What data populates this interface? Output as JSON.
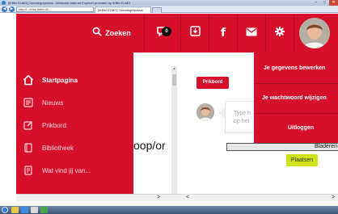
{
  "window": {
    "title": "[IKBM ELMO] Ckemiegrepstaal - Windows Internet Explorer provided by IKBM ELMO",
    "minimize": "–",
    "maximize": "□",
    "close": "✕"
  },
  "browser": {
    "url": "http://...elmo.ikbm.nl/...",
    "tab_label": "[IKBM ELMO] Ckemiegrepstaal",
    "back": "◀",
    "forward": "▶"
  },
  "header": {
    "search_label": "Zoeken",
    "chat_badge": "0",
    "facebook_label": "f"
  },
  "sidebar": {
    "items": [
      {
        "label": "Startpagina",
        "icon": "home-icon"
      },
      {
        "label": "Nieuws",
        "icon": "news-icon"
      },
      {
        "label": "Prikbord",
        "icon": "edit-icon"
      },
      {
        "label": "Bibliotheek",
        "icon": "book-icon"
      },
      {
        "label": "Wat vind jij van...",
        "icon": "feedback-icon"
      }
    ]
  },
  "main": {
    "prikbord_label": "Prikbord",
    "post_placeholder": "Type h op het",
    "cut_heading": "oop/or",
    "file_button_label": "Bladeren",
    "submit_label": "Plaatsen"
  },
  "dropdown": {
    "items": [
      {
        "label": "Je gegevens bewerken"
      },
      {
        "label": "Je wachtwoord wijzigen"
      },
      {
        "label": "Uitloggen"
      }
    ]
  },
  "scrollbars": {
    "left_arrow": "<",
    "right_arrow": ">",
    "up_arrow": "▲",
    "down_arrow": "▼"
  },
  "colors": {
    "brand_red": "#d6102a",
    "submit_green": "#cfe21a"
  }
}
